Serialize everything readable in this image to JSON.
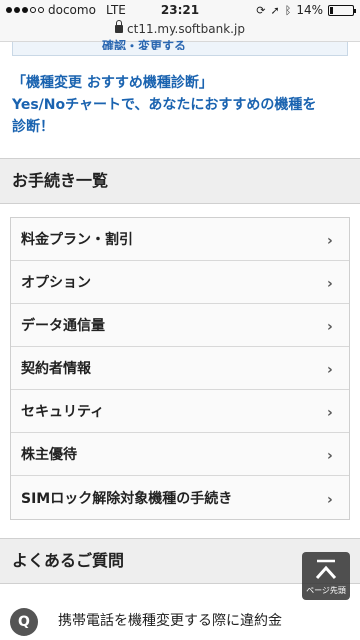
{
  "status_bar": {
    "carrier": "docomo",
    "network": "LTE",
    "time": "23:21",
    "battery": "14%",
    "battery_level": 0.14
  },
  "browser": {
    "url": "ct11.my.softbank.jp"
  },
  "top_link": {
    "text": "確認・変更する"
  },
  "promo": {
    "line1": "「機種変更 おすすめ機種診断」",
    "line2": "Yes/Noチャートで、あなたにおすすめの機種を",
    "line3": "診断！"
  },
  "procedures": {
    "title": "お手続き一覧",
    "items": [
      {
        "label": "料金プラン・割引"
      },
      {
        "label": "オプション"
      },
      {
        "label": "データ通信量"
      },
      {
        "label": "契約者情報"
      },
      {
        "label": "セキュリティ"
      },
      {
        "label": "株主優待"
      },
      {
        "label": "SIMロック解除対象機種の手続き"
      }
    ]
  },
  "faq": {
    "title": "よくあるご質問",
    "q_icon": "Q",
    "first_question": "携帯電話を機種変更する際に違約金"
  },
  "page_top": {
    "label": "ページ先頭"
  },
  "colors": {
    "link_blue": "#1a63b0",
    "header_bg": "#eeeeee",
    "page_top_bg": "#323232"
  }
}
